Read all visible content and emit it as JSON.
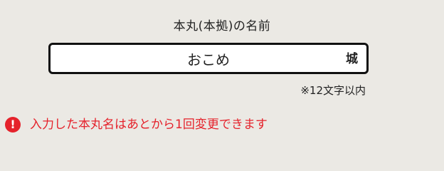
{
  "name_field": {
    "label": "本丸(本拠)の名前",
    "value": "おこめ",
    "suffix": "城",
    "limit_note": "※12文字以内"
  },
  "notice": {
    "icon": "exclamation-circle-icon",
    "text": "入力した本丸名はあとから1回変更できます",
    "color": "#e5222b"
  }
}
